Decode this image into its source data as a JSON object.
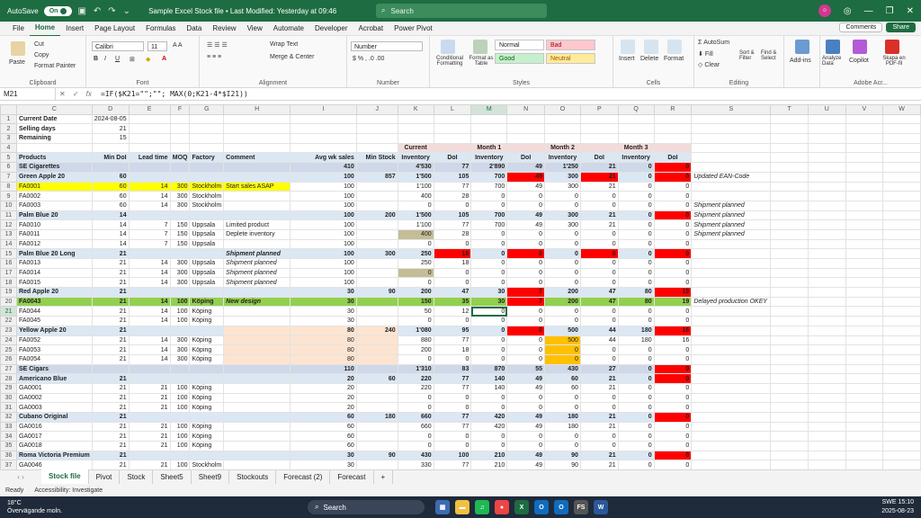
{
  "titlebar": {
    "autosave_label": "AutoSave",
    "autosave_state": "On",
    "title": "Sample Excel Stock file • Last Modified: Yesterday at 09:46",
    "search_placeholder": "Search"
  },
  "menu": {
    "tabs": [
      "File",
      "Home",
      "Insert",
      "Page Layout",
      "Formulas",
      "Data",
      "Review",
      "View",
      "Automate",
      "Developer",
      "Acrobat",
      "Power Pivot"
    ],
    "active": "Home",
    "comments_label": "Comments",
    "share_label": "Share"
  },
  "ribbon": {
    "clipboard": {
      "paste": "Paste",
      "cut": "Cut",
      "copy": "Copy",
      "format_painter": "Format Painter",
      "label": "Clipboard"
    },
    "font": {
      "family": "Calibri",
      "size": "11",
      "label": "Font"
    },
    "alignment": {
      "wrap": "Wrap Text",
      "merge": "Merge & Center",
      "label": "Alignment"
    },
    "number": {
      "format": "Number",
      "label": "Number"
    },
    "styles": {
      "conditional": "Conditional Formatting",
      "format_table": "Format as Table",
      "normal": "Normal",
      "bad": "Bad",
      "good": "Good",
      "neutral": "Neutral",
      "label": "Styles"
    },
    "cells": {
      "insert": "Insert",
      "delete": "Delete",
      "format": "Format",
      "label": "Cells"
    },
    "editing": {
      "autosum": "AutoSum",
      "fill": "Fill",
      "clear": "Clear",
      "sort": "Sort & Filter",
      "find": "Find & Select",
      "label": "Editing"
    },
    "addins": {
      "addins": "Add-ins",
      "analyze": "Analyze Data",
      "copilot": "Copilot",
      "pdf": "Skapa en PDF-fil",
      "label": "Adobe Acr..."
    }
  },
  "formula_bar": {
    "cell": "M21",
    "formula": "=IF($K21=\"\";\"\"; MAX(0;K21-4*$I21))"
  },
  "columns": [
    "C",
    "D",
    "E",
    "F",
    "G",
    "H",
    "I",
    "J",
    "K",
    "L",
    "M",
    "N",
    "O",
    "P",
    "Q",
    "R",
    "S",
    "T",
    "U",
    "V",
    "W"
  ],
  "rows": [
    [
      "Current Date",
      "2024-08-05",
      "",
      "",
      "",
      "",
      "",
      "",
      "",
      "",
      "",
      "",
      "",
      "",
      "",
      "",
      "",
      "",
      "",
      "",
      ""
    ],
    [
      "Selling days",
      "21",
      "",
      "",
      "",
      "",
      "",
      "",
      "",
      "",
      "",
      "",
      "",
      "",
      "",
      "",
      "",
      "",
      "",
      "",
      ""
    ],
    [
      "Remaining",
      "15",
      "",
      "",
      "",
      "",
      "",
      "",
      "",
      "",
      "",
      "",
      "",
      "",
      "",
      "",
      "",
      "",
      "",
      "",
      ""
    ],
    [
      "",
      "",
      "",
      "",
      "",
      "",
      "",
      "",
      "Current",
      "",
      "Month 1",
      "",
      "Month 2",
      "",
      "Month 3",
      "",
      "",
      "",
      "",
      "",
      ""
    ],
    [
      "Products",
      "Min DoI",
      "Lead time",
      "MOQ",
      "Factory",
      "Comment",
      "Avg wk sales",
      "Min Stock",
      "Inventory",
      "DoI",
      "Inventory",
      "DoI",
      "Inventory",
      "DoI",
      "Inventory",
      "DoI",
      "",
      "",
      "",
      "",
      ""
    ],
    [
      "SE Cigarettes",
      "",
      "",
      "",
      "",
      "",
      "410",
      "",
      "4'530",
      "77",
      "2'890",
      "49",
      "1'250",
      "21",
      "0",
      "0",
      "",
      "",
      "",
      "",
      ""
    ],
    [
      "Green Apple 20",
      "60",
      "",
      "",
      "",
      "",
      "100",
      "857",
      "1'500",
      "105",
      "700",
      "49",
      "300",
      "21",
      "0",
      "0",
      "Updated EAN-Code",
      "",
      "",
      "",
      ""
    ],
    [
      "FA0001",
      "60",
      "14",
      "300",
      "Stockholm",
      "Start sales ASAP",
      "100",
      "",
      "1'100",
      "77",
      "700",
      "49",
      "300",
      "21",
      "0",
      "0",
      "",
      "",
      "",
      "",
      ""
    ],
    [
      "FA0002",
      "60",
      "14",
      "300",
      "Stockholm",
      "",
      "100",
      "",
      "400",
      "28",
      "0",
      "0",
      "0",
      "0",
      "0",
      "0",
      "",
      "",
      "",
      "",
      ""
    ],
    [
      "FA0003",
      "60",
      "14",
      "300",
      "Stockholm",
      "",
      "100",
      "",
      "0",
      "0",
      "0",
      "0",
      "0",
      "0",
      "0",
      "0",
      "Shipment planned",
      "",
      "",
      "",
      ""
    ],
    [
      "Palm Blue 20",
      "14",
      "",
      "",
      "",
      "",
      "100",
      "200",
      "1'500",
      "105",
      "700",
      "49",
      "300",
      "21",
      "0",
      "0",
      "Shipment planned",
      "",
      "",
      "",
      ""
    ],
    [
      "FA0010",
      "14",
      "7",
      "150",
      "Uppsala",
      "Limited product",
      "100",
      "",
      "1'100",
      "77",
      "700",
      "49",
      "300",
      "21",
      "0",
      "0",
      "Shipment planned",
      "",
      "",
      "",
      ""
    ],
    [
      "FA0011",
      "14",
      "7",
      "150",
      "Uppsala",
      "Deplete inventory",
      "100",
      "",
      "400",
      "28",
      "0",
      "0",
      "0",
      "0",
      "0",
      "0",
      "Shipment planned",
      "",
      "",
      "",
      ""
    ],
    [
      "FA0012",
      "14",
      "7",
      "150",
      "Uppsala",
      "",
      "100",
      "",
      "0",
      "0",
      "0",
      "0",
      "0",
      "0",
      "0",
      "0",
      "",
      "",
      "",
      "",
      ""
    ],
    [
      "Palm Blue 20 Long",
      "21",
      "",
      "",
      "",
      "Shipment planned",
      "100",
      "300",
      "250",
      "18",
      "0",
      "0",
      "0",
      "0",
      "0",
      "0",
      "",
      "",
      "",
      "",
      ""
    ],
    [
      "FA0013",
      "21",
      "14",
      "300",
      "Uppsala",
      "Shipment planned",
      "100",
      "",
      "250",
      "18",
      "0",
      "0",
      "0",
      "0",
      "0",
      "0",
      "",
      "",
      "",
      "",
      ""
    ],
    [
      "FA0014",
      "21",
      "14",
      "300",
      "Uppsala",
      "Shipment planned",
      "100",
      "",
      "0",
      "0",
      "0",
      "0",
      "0",
      "0",
      "0",
      "0",
      "",
      "",
      "",
      "",
      ""
    ],
    [
      "FA0015",
      "21",
      "14",
      "300",
      "Uppsala",
      "Shipment planned",
      "100",
      "",
      "0",
      "0",
      "0",
      "0",
      "0",
      "0",
      "0",
      "0",
      "",
      "",
      "",
      "",
      ""
    ],
    [
      "Red Apple  20",
      "21",
      "",
      "",
      "",
      "",
      "30",
      "90",
      "200",
      "47",
      "30",
      "7",
      "200",
      "47",
      "80",
      "19",
      "",
      "",
      "",
      "",
      ""
    ],
    [
      "FA0043",
      "21",
      "14",
      "100",
      "Köping",
      "New design",
      "30",
      "",
      "150",
      "35",
      "30",
      "7",
      "200",
      "47",
      "80",
      "19",
      "Delayed production OKEY",
      "",
      "",
      "",
      ""
    ],
    [
      "FA0044",
      "21",
      "14",
      "100",
      "Köping",
      "",
      "30",
      "",
      "50",
      "12",
      "0",
      "0",
      "0",
      "0",
      "0",
      "0",
      "",
      "",
      "",
      "",
      ""
    ],
    [
      "FA0045",
      "21",
      "14",
      "100",
      "Köping",
      "",
      "30",
      "",
      "0",
      "0",
      "0",
      "0",
      "0",
      "0",
      "0",
      "0",
      "",
      "",
      "",
      "",
      ""
    ],
    [
      "Yellow Apple 20",
      "21",
      "",
      "",
      "",
      "",
      "80",
      "240",
      "1'080",
      "95",
      "0",
      "0",
      "500",
      "44",
      "180",
      "16",
      "",
      "",
      "",
      "",
      ""
    ],
    [
      "FA0052",
      "21",
      "14",
      "300",
      "Köping",
      "",
      "80",
      "",
      "880",
      "77",
      "0",
      "0",
      "500",
      "44",
      "180",
      "16",
      "",
      "",
      "",
      "",
      ""
    ],
    [
      "FA0053",
      "21",
      "14",
      "300",
      "Köping",
      "",
      "80",
      "",
      "200",
      "18",
      "0",
      "0",
      "0",
      "0",
      "0",
      "0",
      "",
      "",
      "",
      "",
      ""
    ],
    [
      "FA0054",
      "21",
      "14",
      "300",
      "Köping",
      "",
      "80",
      "",
      "0",
      "0",
      "0",
      "0",
      "0",
      "0",
      "0",
      "0",
      "",
      "",
      "",
      "",
      ""
    ],
    [
      "SE Cigars",
      "",
      "",
      "",
      "",
      "",
      "110",
      "",
      "1'310",
      "83",
      "870",
      "55",
      "430",
      "27",
      "0",
      "0",
      "",
      "",
      "",
      "",
      ""
    ],
    [
      "Americano Blue",
      "21",
      "",
      "",
      "",
      "",
      "20",
      "60",
      "220",
      "77",
      "140",
      "49",
      "60",
      "21",
      "0",
      "0",
      "",
      "",
      "",
      "",
      ""
    ],
    [
      "GA0001",
      "21",
      "21",
      "100",
      "Köping",
      "",
      "20",
      "",
      "220",
      "77",
      "140",
      "49",
      "60",
      "21",
      "0",
      "0",
      "",
      "",
      "",
      "",
      ""
    ],
    [
      "GA0002",
      "21",
      "21",
      "100",
      "Köping",
      "",
      "20",
      "",
      "0",
      "0",
      "0",
      "0",
      "0",
      "0",
      "0",
      "0",
      "",
      "",
      "",
      "",
      ""
    ],
    [
      "GA0003",
      "21",
      "21",
      "100",
      "Köping",
      "",
      "20",
      "",
      "0",
      "0",
      "0",
      "0",
      "0",
      "0",
      "0",
      "0",
      "",
      "",
      "",
      "",
      ""
    ],
    [
      "Cubano Original",
      "21",
      "",
      "",
      "",
      "",
      "60",
      "180",
      "660",
      "77",
      "420",
      "49",
      "180",
      "21",
      "0",
      "0",
      "",
      "",
      "",
      "",
      ""
    ],
    [
      "GA0016",
      "21",
      "21",
      "100",
      "Köping",
      "",
      "60",
      "",
      "660",
      "77",
      "420",
      "49",
      "180",
      "21",
      "0",
      "0",
      "",
      "",
      "",
      "",
      ""
    ],
    [
      "GA0017",
      "21",
      "21",
      "100",
      "Köping",
      "",
      "60",
      "",
      "0",
      "0",
      "0",
      "0",
      "0",
      "0",
      "0",
      "0",
      "",
      "",
      "",
      "",
      ""
    ],
    [
      "GA0018",
      "21",
      "21",
      "100",
      "Köping",
      "",
      "60",
      "",
      "0",
      "0",
      "0",
      "0",
      "0",
      "0",
      "0",
      "0",
      "",
      "",
      "",
      "",
      ""
    ],
    [
      "Roma Victoria Premium",
      "21",
      "",
      "",
      "",
      "",
      "30",
      "90",
      "430",
      "100",
      "210",
      "49",
      "90",
      "21",
      "0",
      "0",
      "",
      "",
      "",
      "",
      ""
    ],
    [
      "GA0046",
      "21",
      "21",
      "100",
      "Stockholm",
      "",
      "30",
      "",
      "330",
      "77",
      "210",
      "49",
      "90",
      "21",
      "0",
      "0",
      "",
      "",
      "",
      "",
      ""
    ]
  ],
  "sheet_tabs": [
    "Stock file",
    "Pivot",
    "Stock",
    "Sheet5",
    "Sheet9",
    "Stockouts",
    "Forecast (2)",
    "Forecast"
  ],
  "active_sheet": "Stock file",
  "status": {
    "ready": "Ready",
    "accessibility": "Accessibility: Investigate"
  },
  "taskbar": {
    "weather_temp": "18°C",
    "weather_desc": "Övervägande moln.",
    "search": "Search",
    "lang": "SWE",
    "time": "15:10",
    "date": "2025-08-23"
  },
  "colors": {
    "excel_green": "#1e6c41",
    "section": "#cfd8e8",
    "group": "#dbe7f3",
    "red": "#ff0000",
    "yellow": "#ffff00",
    "green_row": "#92d050",
    "tan": "#c4bd97",
    "orange": "#ffc000",
    "peach": "#fde4d0"
  }
}
